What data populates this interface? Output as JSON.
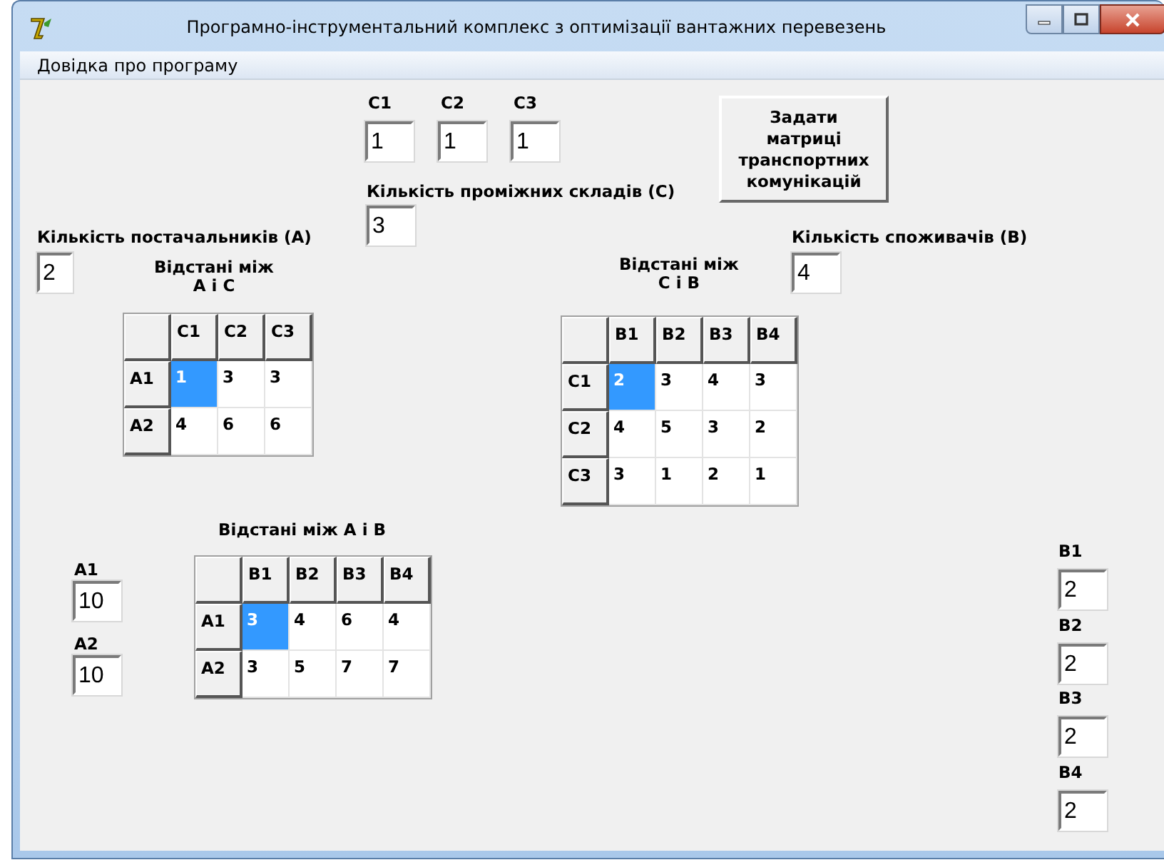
{
  "window": {
    "title": "Програмно-інструментальний комплекс з оптимізації вантажних перевезень"
  },
  "menu": [
    {
      "label": "Довідка про програму"
    }
  ],
  "warehouse_costs": [
    {
      "label": "C1",
      "value": "1"
    },
    {
      "label": "C2",
      "value": "1"
    },
    {
      "label": "C3",
      "value": "1"
    }
  ],
  "button": {
    "label": "Задати матриці транспортних комунікацій"
  },
  "warehouse_count": {
    "label": "Кількість проміжних складів (С)",
    "value": "3"
  },
  "supplier_count": {
    "label": "Кількість постачальників (А)",
    "value": "2"
  },
  "consumer_count": {
    "label": "Кількість споживачів (В)",
    "value": "4"
  },
  "tables": [
    {
      "title": "Відстані між А і С",
      "columns": [
        "C1",
        "C2",
        "C3"
      ],
      "rows": [
        {
          "header": "A1",
          "cells": [
            {
              "text": "1",
              "selected": true
            },
            {
              "text": "3",
              "selected": false
            },
            {
              "text": "3",
              "selected": false
            }
          ]
        },
        {
          "header": "A2",
          "cells": [
            {
              "text": "4",
              "selected": false
            },
            {
              "text": "6",
              "selected": false
            },
            {
              "text": "6",
              "selected": false
            }
          ]
        }
      ]
    },
    {
      "title": "Відстані між С і В",
      "columns": [
        "B1",
        "B2",
        "B3",
        "B4"
      ],
      "rows": [
        {
          "header": "C1",
          "cells": [
            {
              "text": "2",
              "selected": true
            },
            {
              "text": "3",
              "selected": false
            },
            {
              "text": "4",
              "selected": false
            },
            {
              "text": "3",
              "selected": false
            }
          ]
        },
        {
          "header": "C2",
          "cells": [
            {
              "text": "4",
              "selected": false
            },
            {
              "text": "5",
              "selected": false
            },
            {
              "text": "3",
              "selected": false
            },
            {
              "text": "2",
              "selected": false
            }
          ]
        },
        {
          "header": "C3",
          "cells": [
            {
              "text": "3",
              "selected": false
            },
            {
              "text": "1",
              "selected": false
            },
            {
              "text": "2",
              "selected": false
            },
            {
              "text": "1",
              "selected": false
            }
          ]
        }
      ]
    },
    {
      "title": "Відстані між А і В",
      "columns": [
        "B1",
        "B2",
        "B3",
        "B4"
      ],
      "rows": [
        {
          "header": "A1",
          "cells": [
            {
              "text": "3",
              "selected": true
            },
            {
              "text": "4",
              "selected": false
            },
            {
              "text": "6",
              "selected": false
            },
            {
              "text": "4",
              "selected": false
            }
          ]
        },
        {
          "header": "A2",
          "cells": [
            {
              "text": "3",
              "selected": false
            },
            {
              "text": "5",
              "selected": false
            },
            {
              "text": "7",
              "selected": false
            },
            {
              "text": "7",
              "selected": false
            }
          ]
        }
      ]
    }
  ],
  "supplies": [
    {
      "label": "A1",
      "value": "10"
    },
    {
      "label": "A2",
      "value": "10"
    }
  ],
  "demands": [
    {
      "label": "B1",
      "value": "2"
    },
    {
      "label": "B2",
      "value": "2"
    },
    {
      "label": "B3",
      "value": "2"
    },
    {
      "label": "B4",
      "value": "2"
    }
  ]
}
